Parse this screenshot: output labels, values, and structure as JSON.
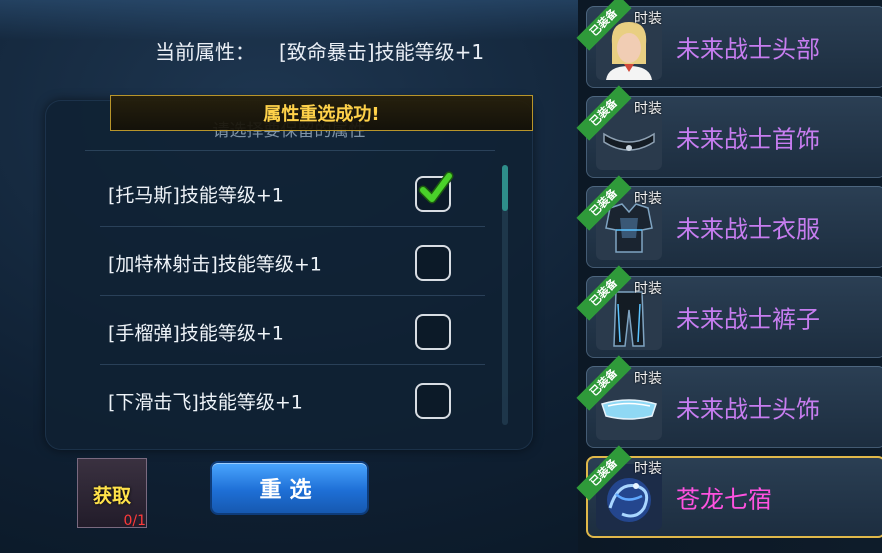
{
  "header": {
    "current_attr_label": "当前属性：",
    "current_attr_value": "[致命暴击]技能等级+1"
  },
  "panel": {
    "select_hint": "请选择要保留的属性",
    "toast": "属性重选成功!"
  },
  "options": [
    {
      "label": "[托马斯]技能等级+1",
      "checked": true
    },
    {
      "label": "[加特林射击]技能等级+1",
      "checked": false
    },
    {
      "label": "[手榴弹]技能等级+1",
      "checked": false
    },
    {
      "label": "[下滑击飞]技能等级+1",
      "checked": false
    }
  ],
  "obtain": {
    "label": "获取",
    "count": "0/1"
  },
  "reselect_button": "重选",
  "items": [
    {
      "name": "未来战士头部",
      "badge": "已装备",
      "tag": "时装",
      "icon": "helmet-portrait-icon"
    },
    {
      "name": "未来战士首饰",
      "badge": "已装备",
      "tag": "时装",
      "icon": "necklace-icon"
    },
    {
      "name": "未来战士衣服",
      "badge": "已装备",
      "tag": "时装",
      "icon": "armor-icon"
    },
    {
      "name": "未来战士裤子",
      "badge": "已装备",
      "tag": "时装",
      "icon": "pants-icon"
    },
    {
      "name": "未来战士头饰",
      "badge": "已装备",
      "tag": "时装",
      "icon": "visor-icon"
    },
    {
      "name": "苍龙七宿",
      "badge": "已装备",
      "tag": "时装",
      "icon": "blue-dragon-icon",
      "selected": true
    }
  ],
  "colors": {
    "item_name": "#c77df0",
    "legend_item_name": "#ff52e0",
    "toast_text": "#ffd24a",
    "button_blue": "#1e6fd6",
    "checkmark_green": "#4ad12a"
  }
}
